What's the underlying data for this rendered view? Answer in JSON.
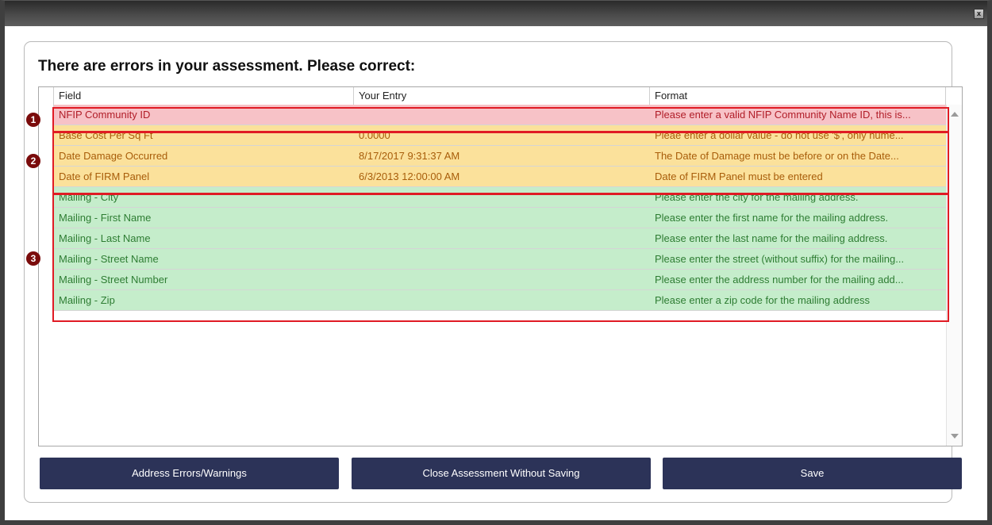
{
  "window": {
    "close_glyph": "x"
  },
  "dialog": {
    "heading": "There are errors in your assessment. Please correct:",
    "columns": {
      "field": "Field",
      "entry": "Your Entry",
      "format": "Format"
    },
    "rows": [
      {
        "field": "NFIP Community ID",
        "entry": "",
        "format": "Please enter a valid NFIP Community Name ID, this is...",
        "severity": "error"
      },
      {
        "field": "Base Cost Per Sq Ft",
        "entry": "0.0000",
        "format": "Pleae enter a dollar value - do not use '$', only nume...",
        "severity": "warning"
      },
      {
        "field": "Date Damage Occurred",
        "entry": "8/17/2017 9:31:37 AM",
        "format": "The Date of Damage must be before or on the Date...",
        "severity": "warning"
      },
      {
        "field": "Date of FIRM Panel",
        "entry": "6/3/2013 12:00:00 AM",
        "format": "Date of FIRM Panel must be entered",
        "severity": "warning"
      },
      {
        "field": "Mailing - City",
        "entry": "",
        "format": "Please enter the city for the mailing address.",
        "severity": "missing"
      },
      {
        "field": "Mailing - First Name",
        "entry": "",
        "format": "Please enter the first name for the mailing address.",
        "severity": "missing"
      },
      {
        "field": "Mailing - Last Name",
        "entry": "",
        "format": "Please enter the last name for the mailing address.",
        "severity": "missing"
      },
      {
        "field": "Mailing - Street Name",
        "entry": "",
        "format": "Please enter the street (without suffix) for the mailing...",
        "severity": "missing"
      },
      {
        "field": "Mailing - Street Number",
        "entry": "",
        "format": "Please enter the address number for the mailing add...",
        "severity": "missing"
      },
      {
        "field": "Mailing - Zip",
        "entry": "",
        "format": "Please enter a zip code for the mailing address",
        "severity": "missing"
      }
    ],
    "markers": [
      "1",
      "2",
      "3"
    ],
    "buttons": {
      "address": "Address Errors/Warnings",
      "close": "Close Assessment Without Saving",
      "save": "Save"
    }
  },
  "colors": {
    "error_bg": "#f7c2c7",
    "error_text": "#b11d28",
    "warning_bg": "#fbe19b",
    "warning_text": "#a85d0a",
    "missing_bg": "#c5edcb",
    "missing_text": "#2e7d33",
    "highlight": "#e01b24",
    "button_bg": "#2c3358"
  }
}
